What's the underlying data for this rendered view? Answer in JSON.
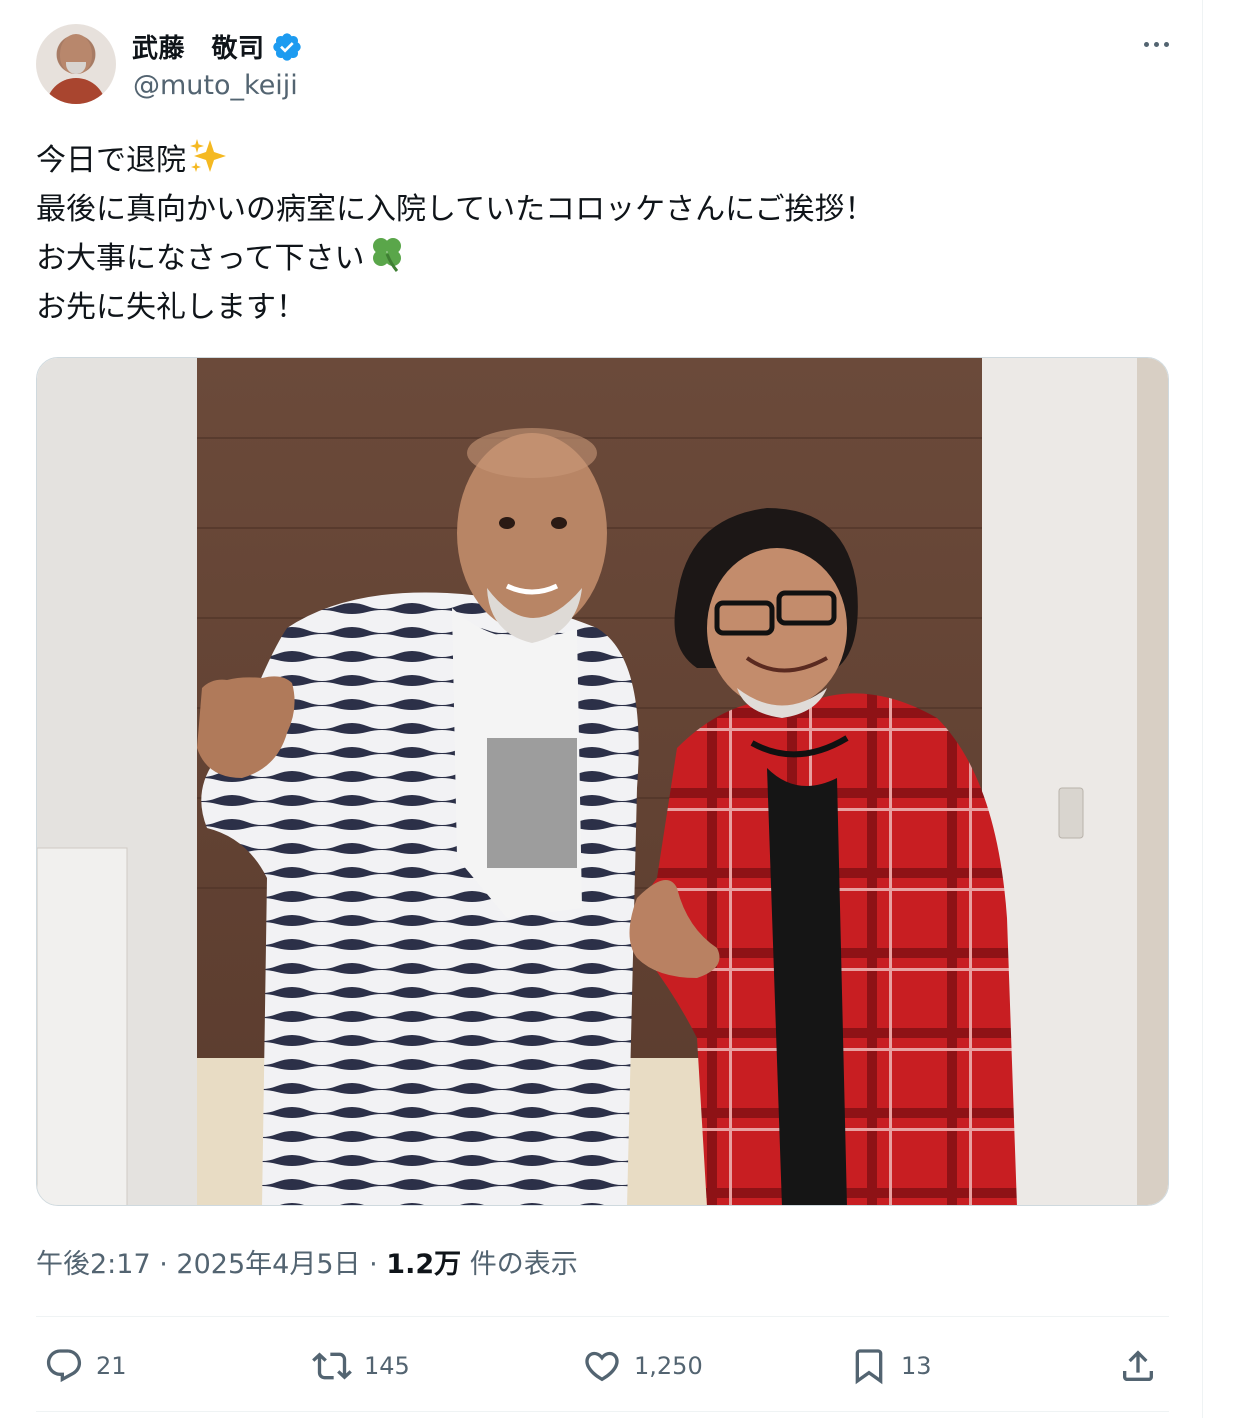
{
  "author": {
    "display_name": "武藤　敬司",
    "handle": "@muto_keiji",
    "verified": true
  },
  "tweet": {
    "lines": [
      {
        "text": "今日で退院",
        "emoji": "sparkles-icon"
      },
      {
        "text": "最後に真向かいの病室に入院していたコロッケさんにご挨拶！",
        "emoji": ""
      },
      {
        "text": "お大事になさって下さい",
        "emoji": "four-leaf-clover-icon"
      },
      {
        "text": "お先に失礼します！",
        "emoji": ""
      }
    ]
  },
  "meta": {
    "time": "午後2:17",
    "separator": "·",
    "date": "2025年4月5日",
    "views_count": "1.2万",
    "views_label": "件の表示"
  },
  "actions": {
    "replies": "21",
    "reposts": "145",
    "likes": "1,250",
    "bookmarks": "13"
  },
  "colors": {
    "verified_blue": "#1d9bf0",
    "secondary_text": "#536471",
    "primary_text": "#0f1419",
    "divider": "#eff3f4"
  }
}
